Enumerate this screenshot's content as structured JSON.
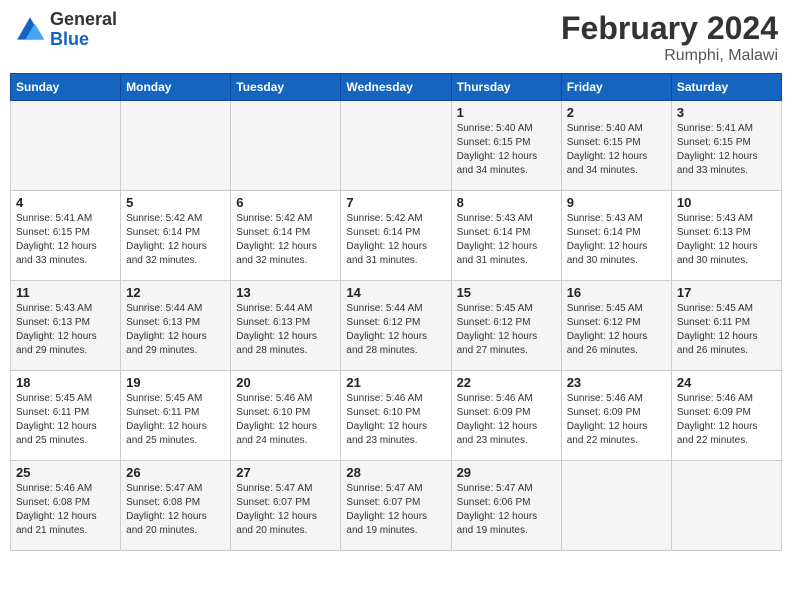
{
  "logo": {
    "text_general": "General",
    "text_blue": "Blue"
  },
  "header": {
    "month_year": "February 2024",
    "location": "Rumphi, Malawi"
  },
  "days_of_week": [
    "Sunday",
    "Monday",
    "Tuesday",
    "Wednesday",
    "Thursday",
    "Friday",
    "Saturday"
  ],
  "weeks": [
    [
      {
        "day": "",
        "info": ""
      },
      {
        "day": "",
        "info": ""
      },
      {
        "day": "",
        "info": ""
      },
      {
        "day": "",
        "info": ""
      },
      {
        "day": "1",
        "info": "Sunrise: 5:40 AM\nSunset: 6:15 PM\nDaylight: 12 hours\nand 34 minutes."
      },
      {
        "day": "2",
        "info": "Sunrise: 5:40 AM\nSunset: 6:15 PM\nDaylight: 12 hours\nand 34 minutes."
      },
      {
        "day": "3",
        "info": "Sunrise: 5:41 AM\nSunset: 6:15 PM\nDaylight: 12 hours\nand 33 minutes."
      }
    ],
    [
      {
        "day": "4",
        "info": "Sunrise: 5:41 AM\nSunset: 6:15 PM\nDaylight: 12 hours\nand 33 minutes."
      },
      {
        "day": "5",
        "info": "Sunrise: 5:42 AM\nSunset: 6:14 PM\nDaylight: 12 hours\nand 32 minutes."
      },
      {
        "day": "6",
        "info": "Sunrise: 5:42 AM\nSunset: 6:14 PM\nDaylight: 12 hours\nand 32 minutes."
      },
      {
        "day": "7",
        "info": "Sunrise: 5:42 AM\nSunset: 6:14 PM\nDaylight: 12 hours\nand 31 minutes."
      },
      {
        "day": "8",
        "info": "Sunrise: 5:43 AM\nSunset: 6:14 PM\nDaylight: 12 hours\nand 31 minutes."
      },
      {
        "day": "9",
        "info": "Sunrise: 5:43 AM\nSunset: 6:14 PM\nDaylight: 12 hours\nand 30 minutes."
      },
      {
        "day": "10",
        "info": "Sunrise: 5:43 AM\nSunset: 6:13 PM\nDaylight: 12 hours\nand 30 minutes."
      }
    ],
    [
      {
        "day": "11",
        "info": "Sunrise: 5:43 AM\nSunset: 6:13 PM\nDaylight: 12 hours\nand 29 minutes."
      },
      {
        "day": "12",
        "info": "Sunrise: 5:44 AM\nSunset: 6:13 PM\nDaylight: 12 hours\nand 29 minutes."
      },
      {
        "day": "13",
        "info": "Sunrise: 5:44 AM\nSunset: 6:13 PM\nDaylight: 12 hours\nand 28 minutes."
      },
      {
        "day": "14",
        "info": "Sunrise: 5:44 AM\nSunset: 6:12 PM\nDaylight: 12 hours\nand 28 minutes."
      },
      {
        "day": "15",
        "info": "Sunrise: 5:45 AM\nSunset: 6:12 PM\nDaylight: 12 hours\nand 27 minutes."
      },
      {
        "day": "16",
        "info": "Sunrise: 5:45 AM\nSunset: 6:12 PM\nDaylight: 12 hours\nand 26 minutes."
      },
      {
        "day": "17",
        "info": "Sunrise: 5:45 AM\nSunset: 6:11 PM\nDaylight: 12 hours\nand 26 minutes."
      }
    ],
    [
      {
        "day": "18",
        "info": "Sunrise: 5:45 AM\nSunset: 6:11 PM\nDaylight: 12 hours\nand 25 minutes."
      },
      {
        "day": "19",
        "info": "Sunrise: 5:45 AM\nSunset: 6:11 PM\nDaylight: 12 hours\nand 25 minutes."
      },
      {
        "day": "20",
        "info": "Sunrise: 5:46 AM\nSunset: 6:10 PM\nDaylight: 12 hours\nand 24 minutes."
      },
      {
        "day": "21",
        "info": "Sunrise: 5:46 AM\nSunset: 6:10 PM\nDaylight: 12 hours\nand 23 minutes."
      },
      {
        "day": "22",
        "info": "Sunrise: 5:46 AM\nSunset: 6:09 PM\nDaylight: 12 hours\nand 23 minutes."
      },
      {
        "day": "23",
        "info": "Sunrise: 5:46 AM\nSunset: 6:09 PM\nDaylight: 12 hours\nand 22 minutes."
      },
      {
        "day": "24",
        "info": "Sunrise: 5:46 AM\nSunset: 6:09 PM\nDaylight: 12 hours\nand 22 minutes."
      }
    ],
    [
      {
        "day": "25",
        "info": "Sunrise: 5:46 AM\nSunset: 6:08 PM\nDaylight: 12 hours\nand 21 minutes."
      },
      {
        "day": "26",
        "info": "Sunrise: 5:47 AM\nSunset: 6:08 PM\nDaylight: 12 hours\nand 20 minutes."
      },
      {
        "day": "27",
        "info": "Sunrise: 5:47 AM\nSunset: 6:07 PM\nDaylight: 12 hours\nand 20 minutes."
      },
      {
        "day": "28",
        "info": "Sunrise: 5:47 AM\nSunset: 6:07 PM\nDaylight: 12 hours\nand 19 minutes."
      },
      {
        "day": "29",
        "info": "Sunrise: 5:47 AM\nSunset: 6:06 PM\nDaylight: 12 hours\nand 19 minutes."
      },
      {
        "day": "",
        "info": ""
      },
      {
        "day": "",
        "info": ""
      }
    ]
  ]
}
